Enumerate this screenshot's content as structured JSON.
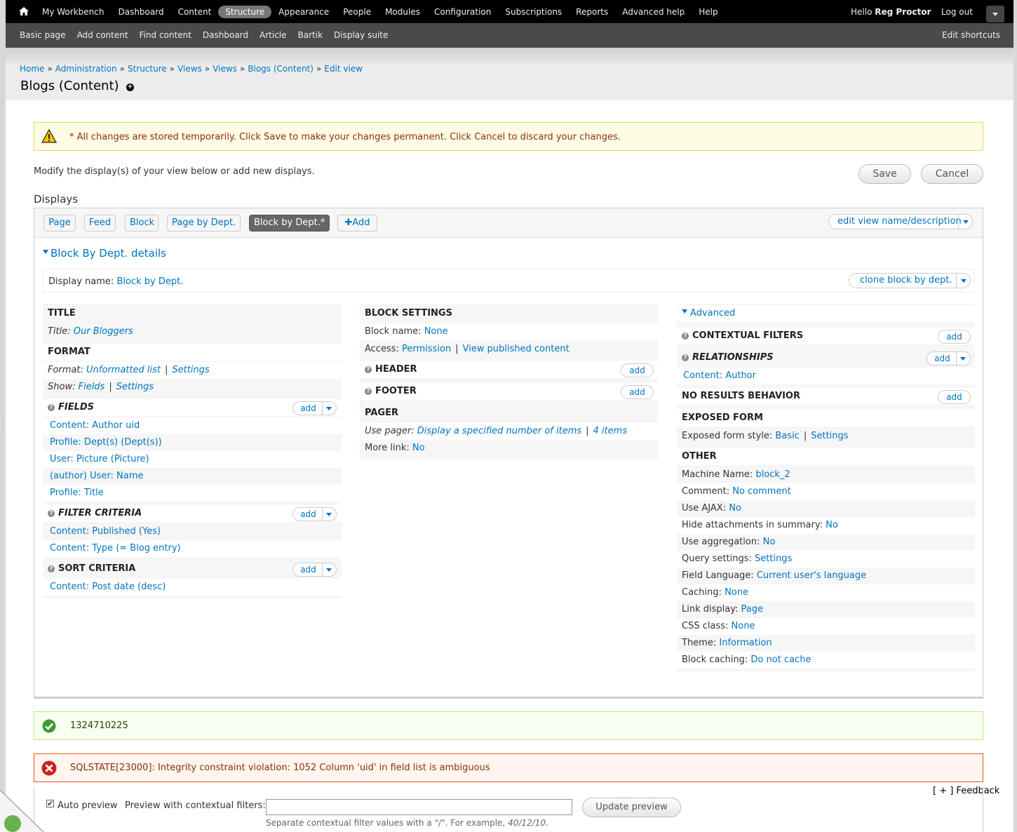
{
  "toolbar": {
    "menu": [
      "My Workbench",
      "Dashboard",
      "Content",
      "Structure",
      "Appearance",
      "People",
      "Modules",
      "Configuration",
      "Subscriptions",
      "Reports",
      "Advanced help",
      "Help"
    ],
    "active": "Structure",
    "hello": "Hello",
    "user": "Reg Proctor",
    "logout": "Log out"
  },
  "shortcuts": {
    "items": [
      "Basic page",
      "Add content",
      "Find content",
      "Dashboard",
      "Article",
      "Bartik",
      "Display suite"
    ],
    "edit": "Edit shortcuts"
  },
  "breadcrumb": [
    "Home",
    "Administration",
    "Structure",
    "Views",
    "Views",
    "Blogs (Content)",
    "Edit view"
  ],
  "page_title": "Blogs (Content)",
  "warning": "* All changes are stored temporarily. Click Save to make your changes permanent. Click Cancel to discard your changes.",
  "intro": "Modify the display(s) of your view below or add new displays.",
  "buttons": {
    "save": "Save",
    "cancel": "Cancel",
    "update_preview": "Update preview"
  },
  "displays_heading": "Displays",
  "tabs": [
    "Page",
    "Feed",
    "Block",
    "Page by Dept.",
    "Block by Dept.*",
    "Add"
  ],
  "active_tab": "Block by Dept.*",
  "edit_view_name": "edit view name/description",
  "details_heading": "Block By Dept. details",
  "display_name": {
    "label": "Display name:",
    "value": "Block by Dept.",
    "clone": "clone block by dept."
  },
  "col1": {
    "title_h": "TITLE",
    "title_label": "Title:",
    "title_value": "Our Bloggers",
    "format_h": "FORMAT",
    "format_label": "Format:",
    "format_value": "Unformatted list",
    "format_settings": "Settings",
    "show_label": "Show:",
    "show_value": "Fields",
    "show_settings": "Settings",
    "fields_h": "FIELDS",
    "fields": [
      "Content: Author uid",
      "Profile: Dept(s) (Dept(s))",
      "User: Picture (Picture)",
      "(author) User: Name",
      "Profile: Title"
    ],
    "filter_h": "FILTER CRITERIA",
    "filters": [
      "Content: Published (Yes)",
      "Content: Type (= Blog entry)"
    ],
    "sort_h": "SORT CRITERIA",
    "sorts": [
      "Content: Post date (desc)"
    ],
    "add": "add"
  },
  "col2": {
    "block_h": "BLOCK SETTINGS",
    "block_name_label": "Block name:",
    "block_name_value": "None",
    "access_label": "Access:",
    "access_value": "Permission",
    "access_value2": "View published content",
    "header_h": "HEADER",
    "footer_h": "FOOTER",
    "pager_h": "PAGER",
    "pager_label": "Use pager:",
    "pager_value": "Display a specified number of items",
    "pager_items": "4 items",
    "more_label": "More link:",
    "more_value": "No",
    "add": "add"
  },
  "col3": {
    "advanced": "Advanced",
    "contextual_h": "CONTEXTUAL FILTERS",
    "relationships_h": "RELATIONSHIPS",
    "relationship_item": "Content: Author",
    "no_results_h": "NO RESULTS BEHAVIOR",
    "exposed_h": "EXPOSED FORM",
    "exposed_label": "Exposed form style:",
    "exposed_value": "Basic",
    "exposed_settings": "Settings",
    "other_h": "OTHER",
    "other": [
      {
        "label": "Machine Name:",
        "value": "block_2"
      },
      {
        "label": "Comment:",
        "value": "No comment"
      },
      {
        "label": "Use AJAX:",
        "value": "No"
      },
      {
        "label": "Hide attachments in summary:",
        "value": "No"
      },
      {
        "label": "Use aggregation:",
        "value": "No"
      },
      {
        "label": "Query settings:",
        "value": "Settings"
      },
      {
        "label": "Field Language:",
        "value": "Current user's language"
      },
      {
        "label": "Caching:",
        "value": "None"
      },
      {
        "label": "Link display:",
        "value": "Page"
      },
      {
        "label": "CSS class:",
        "value": "None"
      },
      {
        "label": "Theme:",
        "value": "Information"
      },
      {
        "label": "Block caching:",
        "value": "Do not cache"
      }
    ],
    "add": "add"
  },
  "status_message": "1324710225",
  "error_message": "SQLSTATE[23000]: Integrity constraint violation: 1052 Column 'uid' in field list is ambiguous",
  "feedback": "[ + ] Feedback",
  "preview": {
    "auto_preview": "Auto preview",
    "auto_checked": true,
    "contextual_label": "Preview with contextual filters:",
    "contextual_value": "",
    "hint_prefix": "Separate contextual filter values with a \"/\". For example,",
    "hint_example": "40/12/10",
    "hint_suffix": "."
  }
}
